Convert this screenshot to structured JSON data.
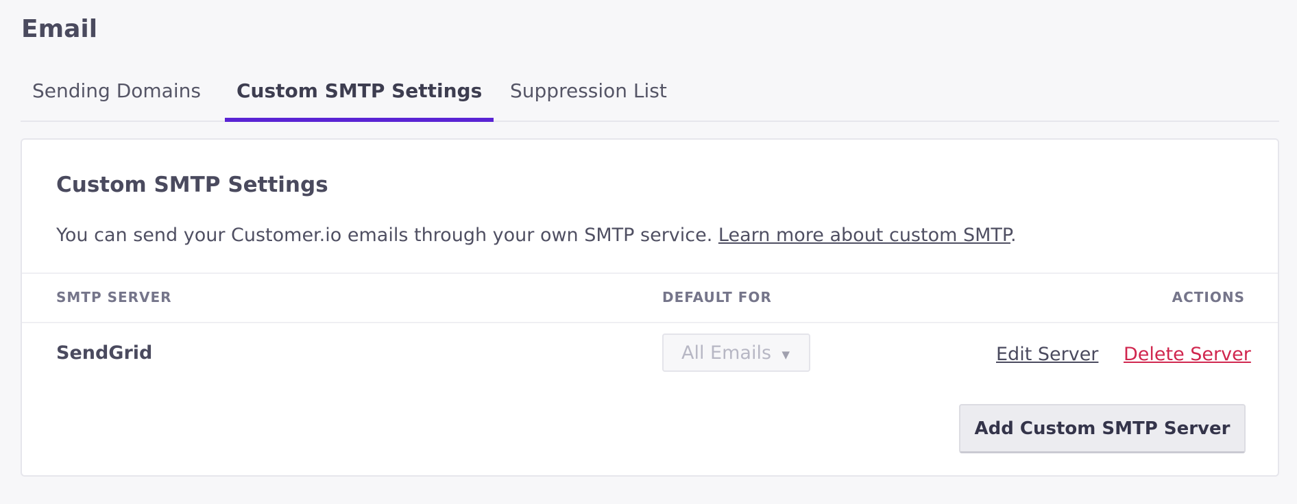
{
  "page": {
    "title": "Email"
  },
  "tabs": [
    {
      "label": "Sending Domains",
      "active": false
    },
    {
      "label": "Custom SMTP Settings",
      "active": true
    },
    {
      "label": "Suppression List",
      "active": false
    }
  ],
  "card": {
    "title": "Custom SMTP Settings",
    "description": "You can send your Customer.io emails through your own SMTP service.",
    "learn_more_link": "Learn more about custom SMTP",
    "description_end": "."
  },
  "table": {
    "headers": [
      "SMTP SERVER",
      "DEFAULT FOR",
      "ACTIONS"
    ],
    "rows": [
      {
        "server": "SendGrid",
        "default_for": "All Emails",
        "edit_label": "Edit Server",
        "delete_label": "Delete Server"
      }
    ]
  },
  "add_button_label": "Add Custom SMTP Server",
  "colors": {
    "accent": "#5a24d4",
    "danger": "#d0264e",
    "background": "#f7f7f9"
  },
  "icons": {
    "select_caret": "caret-down-icon"
  }
}
